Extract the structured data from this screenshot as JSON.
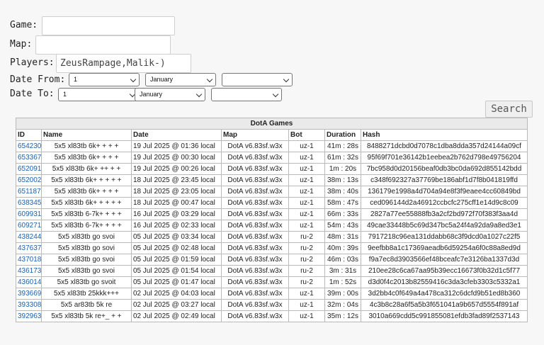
{
  "form": {
    "game_label": "Game:",
    "game_value": "",
    "map_label": "Map:",
    "map_value": "",
    "players_label": "Players:",
    "players_value": "ZeusRampage,Malik-)",
    "date_from_label": "Date From:",
    "date_from_day": "1",
    "date_from_month": "January",
    "date_from_year": "",
    "date_to_label": "Date To:",
    "date_to_day": "1",
    "date_to_month": "January",
    "date_to_year": "",
    "search_label": "Search"
  },
  "table": {
    "caption": "DotA Games",
    "headers": [
      "ID",
      "Name",
      "Date",
      "Map",
      "Bot",
      "Duration",
      "Hash"
    ],
    "rows": [
      [
        "654230",
        "5x5 xl83tb 6k+ + + +",
        "19 Jul 2025 @ 01:36 local",
        "DotA v6.83sf.w3x",
        "uz-1",
        "41m : 28s",
        "8488271dcbd0d7078c1dba8dda357d24144a09cf"
      ],
      [
        "653367",
        "5x5 xl83tb 6k+ + + +",
        "19 Jul 2025 @ 00:30 local",
        "DotA v6.83sf.w3x",
        "uz-1",
        "61m : 32s",
        "95f69f701e36142b1eebea2b762d798e49756204"
      ],
      [
        "652091",
        "5x5 xl83tb 6k+ ++ + +",
        "19 Jul 2025 @ 00:26 local",
        "DotA v6.83sf.w3x",
        "uz-1",
        "1m : 20s",
        "7bc958d0d20156beaf0db3bc0da692d855142bdd"
      ],
      [
        "652002",
        "5x5 xl83tb 6k+ + + + +",
        "18 Jul 2025 @ 23:45 local",
        "DotA v6.83sf.w3x",
        "uz-1",
        "38m : 13s",
        "c348f692327a37769be186abf1d7f8b041819ffd"
      ],
      [
        "651187",
        "5x5 xl83tb 6k+ + + +",
        "18 Jul 2025 @ 23:05 local",
        "DotA v6.83sf.w3x",
        "uz-1",
        "38m : 40s",
        "136179e1998a4d704a94e8f3f9eaee4cc60849bd"
      ],
      [
        "638345",
        "5x5 xl83tb 6k+ + + + +",
        "18 Jul 2025 @ 00:47 local",
        "DotA v6.83sf.w3x",
        "uz-1",
        "58m : 47s",
        "ced096144d2a46912ccbcfc275cff1e14d9c8c09"
      ],
      [
        "609931",
        "5x5 xl83tb 6-7k+ + + +",
        "16 Jul 2025 @ 03:29 local",
        "DotA v6.83sf.w3x",
        "uz-1",
        "66m : 33s",
        "2827a77ee55888fb3a2cf2bd972f70f383f3aa4d"
      ],
      [
        "609271",
        "5x5 xl83tb 6-7k+ + + +",
        "16 Jul 2025 @ 02:33 local",
        "DotA v6.83sf.w3x",
        "uz-1",
        "54m : 43s",
        "49cae33448b5c69d347bc5a24f4a92da9a8ed3e1"
      ],
      [
        "438244",
        "5x5 xl83tb go svoi",
        "05 Jul 2025 @ 03:34 local",
        "DotA v6.83sf.w3x",
        "ru-2",
        "48m : 31s",
        "7917218c96ea131ddabb68c3f9dcd0a1027c22f5"
      ],
      [
        "437637",
        "5x5 xl83tb go sovi",
        "05 Jul 2025 @ 02:48 local",
        "DotA v6.83sf.w3x",
        "ru-2",
        "40m : 39s",
        "9eefbb8a1c17369aeadb6d59254a6f0c88a8ed9d"
      ],
      [
        "437018",
        "5x5 xl83tb go svoi",
        "05 Jul 2025 @ 01:59 local",
        "DotA v6.83sf.w3x",
        "ru-2",
        "46m : 03s",
        "f9a7ec8d3903566ef48bceafc7e3126ba1337d3d"
      ],
      [
        "436173",
        "5x5 xl83tb go svoi",
        "05 Jul 2025 @ 01:54 local",
        "DotA v6.83sf.w3x",
        "ru-2",
        "3m : 31s",
        "210ee28c6ca67aa95b39ecc16673f0b32d1c5f77"
      ],
      [
        "436014",
        "5x5 xl83tb go svoit",
        "05 Jul 2025 @ 01:47 local",
        "DotA v6.83sf.w3x",
        "ru-2",
        "1m : 52s",
        "d3d0f4c2013b82559416c3da3cfeb3303c5332a1"
      ],
      [
        "393669",
        "5x5 xl83tb 25kkk+++",
        "02 Jul 2025 @ 04:03 local",
        "DotA v6.83sf.w3x",
        "uz-1",
        "39m : 00s",
        "3d2bb4c0f649a4a478ca312c6dcfd9b51ed8b360"
      ],
      [
        "393308",
        "5x5 ar83tb 5k re",
        "02 Jul 2025 @ 03:27 local",
        "DotA v6.83sf.w3x",
        "uz-1",
        "32m : 04s",
        "4c3b8c28a6f5a5b3f651041a9b657d5554f891af"
      ],
      [
        "392963",
        "5x5 xl83tb 5k re+_ + +",
        "02 Jul 2025 @ 02:49 local",
        "DotA v6.83sf.w3x",
        "uz-1",
        "35m : 12s",
        "3010a669cdd5c991855081efdb3fad89f2537143"
      ]
    ]
  }
}
